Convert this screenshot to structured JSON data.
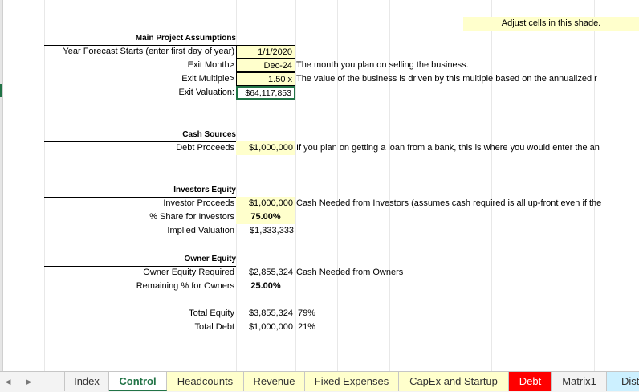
{
  "hint": "Adjust cells in this shade.",
  "assumptions": {
    "header": "Main Project Assumptions",
    "rows": [
      {
        "label": "Year Forecast Starts (enter first day of year)",
        "value": "1/1/2020",
        "note": ""
      },
      {
        "label": "Exit Month>",
        "value": "Dec-24",
        "note": "The month you plan on selling the business."
      },
      {
        "label": "Exit Multiple>",
        "value": "1.50 x",
        "note": "The value of the business is driven by this multiple based on the annualized r"
      },
      {
        "label": "Exit Valuation:",
        "value": "$64,117,853",
        "note": ""
      }
    ]
  },
  "cash_sources": {
    "header": "Cash Sources",
    "rows": [
      {
        "label": "Debt Proceeds",
        "value": "$1,000,000",
        "note": "If you plan on getting a loan from a bank, this is where you would enter the an"
      }
    ]
  },
  "investors": {
    "header": "Investors Equity",
    "rows": [
      {
        "label": "Investor Proceeds",
        "value": "$1,000,000",
        "note": "Cash Needed from Investors (assumes cash required is all up-front even if the"
      },
      {
        "label": "% Share for Investors",
        "value": "75.00%",
        "note": ""
      },
      {
        "label": "Implied Valuation",
        "value": "$1,333,333",
        "note": ""
      }
    ]
  },
  "owner": {
    "header": "Owner Equity",
    "rows": [
      {
        "label": "Owner Equity Required",
        "value": "$2,855,324",
        "note": "Cash Needed from Owners"
      },
      {
        "label": "Remaining % for Owners",
        "value": "25.00%",
        "note": ""
      }
    ]
  },
  "totals": [
    {
      "label": "Total Equity",
      "value": "$3,855,324",
      "pct": "79%"
    },
    {
      "label": "Total Debt",
      "value": "$1,000,000",
      "pct": "21%"
    }
  ],
  "tabs": [
    {
      "label": "Index",
      "active": false,
      "color": ""
    },
    {
      "label": "Control",
      "active": true,
      "color": ""
    },
    {
      "label": "Headcounts",
      "active": false,
      "color": "#ffffcc"
    },
    {
      "label": "Revenue",
      "active": false,
      "color": "#ffffcc"
    },
    {
      "label": "Fixed Expenses",
      "active": false,
      "color": "#ffffcc"
    },
    {
      "label": "CapEx and Startup",
      "active": false,
      "color": "#ffffcc"
    },
    {
      "label": "Debt",
      "active": false,
      "color": "#ff0000"
    },
    {
      "label": "Matrix1",
      "active": false,
      "color": ""
    },
    {
      "label": "Dist",
      "active": false,
      "color": "#ccf0ff"
    }
  ]
}
